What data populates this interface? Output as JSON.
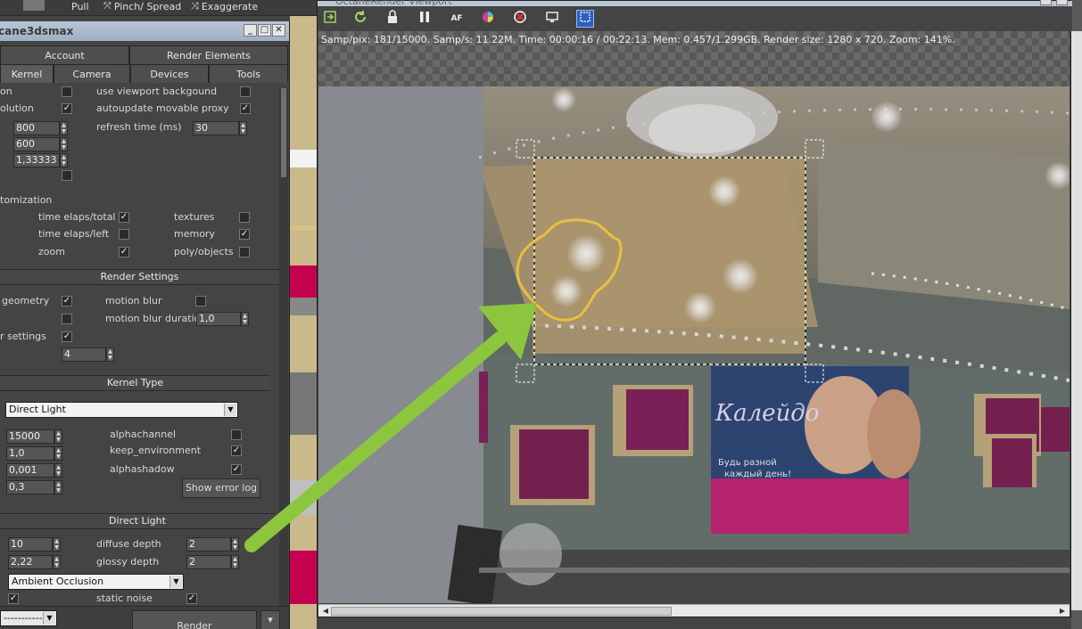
{
  "max_toolbar": {
    "pull_label": "Pull",
    "pinch_label": "Pinch/ Spread",
    "exaggerate_label": "Exaggerate"
  },
  "panel": {
    "title": "cane3dsmax",
    "tabs_row1": [
      "Account",
      "Render Elements"
    ],
    "tabs_row2": [
      "Kernel",
      "Camera",
      "Devices",
      "Tools"
    ],
    "top": {
      "label_on": "on",
      "use_viewport_bg": "use viewport backgound",
      "label_resolution": "olution",
      "autoupdate_proxy": "autoupdate movable proxy",
      "refresh_label": "refresh time (ms)",
      "width": "800",
      "height": "600",
      "aspect": "1,33333",
      "refresh_value": "30"
    },
    "customization": {
      "label": "tomization",
      "time_elaps_total": "time elaps/total",
      "time_elaps_left": "time elaps/left",
      "zoom": "zoom",
      "textures": "textures",
      "memory": "memory",
      "poly_objects": "poly/objects"
    },
    "render_settings": {
      "header": "Render Settings",
      "geometry": "geometry",
      "motion_blur": "motion blur",
      "motion_blur_duration": "motion blur duration",
      "motion_blur_duration_value": "1,0",
      "r_settings": "r settings",
      "value4": "4"
    },
    "kernel_type": {
      "header": "Kernel Type",
      "selected": "Direct Light",
      "max_samples": "15000",
      "v2": "1,0",
      "v3": "0,001",
      "v4": "0,3",
      "alphachannel": "alphachannel",
      "keep_environment": "keep_environment",
      "alphashadow": "alphashadow",
      "show_error_log": "Show error log"
    },
    "direct_light": {
      "header": "Direct Light",
      "v1": "10",
      "v2": "2,22",
      "diffuse_depth": "diffuse depth",
      "diffuse_depth_value": "2",
      "glossy_depth": "glossy depth",
      "glossy_depth_value": "2",
      "gi_mode": "Ambient Occlusion",
      "static_noise": "static noise"
    },
    "bottom": {
      "dropdown": "-----------",
      "render_button": "Render"
    }
  },
  "viewport": {
    "title": "OctaneRender Viewport",
    "stats": "Samp/pix: 181/15000.   Samp/s: 11.22M.   Time: 00:00:16 / 00:22:13.   Mem: 0.457/1.299GB.   Render size: 1280 x 720.   Zoom: 141%.",
    "toolbar_icons": [
      "send-scene-icon",
      "restart-icon",
      "lock-icon",
      "pause-icon",
      "af-icon",
      "color-icon",
      "clear-icon",
      "display-icon",
      "region-render-icon"
    ],
    "billboard_line1": "Будь разной",
    "billboard_line2": "каждый день!",
    "billboard_brand": "Калейдо"
  },
  "colors": {
    "arrow": "#8cc63f",
    "selection_outline": "#e8c040",
    "active_icon": "#2d5fc4",
    "billboard_magenta": "#c0146c"
  }
}
